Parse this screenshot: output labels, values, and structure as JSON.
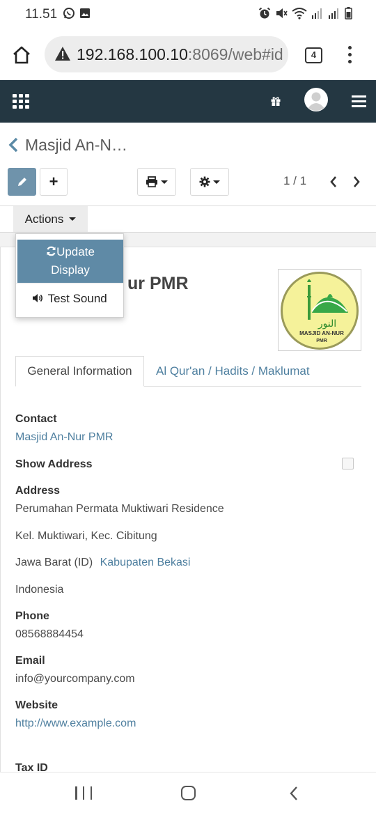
{
  "status_bar": {
    "time": "11.51",
    "left_icons": [
      "whatsapp-icon",
      "image-icon"
    ],
    "right_icons": [
      "alarm-icon",
      "mute-icon",
      "wifi-icon",
      "signal-icon",
      "signal-icon",
      "battery-icon"
    ]
  },
  "browser": {
    "url_host": "192.168.100.10",
    "url_rest": ":8069/web#id",
    "tab_count": "4",
    "icons": [
      "home-icon",
      "warning-icon",
      "tabs-icon",
      "menu-dots-icon"
    ]
  },
  "navbar": {
    "icons": [
      "apps-grid-icon",
      "gift-icon",
      "avatar-icon",
      "hamburger-icon"
    ],
    "color": "#243742"
  },
  "breadcrumb": {
    "title": "Masjid An-N…"
  },
  "control_panel": {
    "pager": "1 / 1",
    "add_label": "+",
    "accent": "#6f93ab"
  },
  "actions": {
    "label": "Actions",
    "dropdown": {
      "update_line1": "Update",
      "update_line2": "Display",
      "test_sound": "Test Sound"
    }
  },
  "record": {
    "title_visible": "ur PMR",
    "logo_text_arabic": "النور",
    "logo_text_line1": "MASJID AN-NUR",
    "logo_text_line2": "PMR"
  },
  "tabs": [
    {
      "label": "General Information",
      "active": true
    },
    {
      "label": "Al Qur'an / Hadits / Maklumat",
      "active": false
    }
  ],
  "fields": {
    "contact_label": "Contact",
    "contact_value": "Masjid An-Nur PMR",
    "show_address_label": "Show Address",
    "show_address_checked": false,
    "address_label": "Address",
    "address_line1": "Perumahan Permata Muktiwari Residence",
    "address_line2": "Kel. Muktiwari, Kec. Cibitung",
    "address_state": "Jawa Barat (ID)",
    "address_city": "Kabupaten Bekasi",
    "address_country": "Indonesia",
    "phone_label": "Phone",
    "phone_value": "08568884454",
    "email_label": "Email",
    "email_value": "info@yourcompany.com",
    "website_label": "Website",
    "website_value": "http://www.example.com",
    "taxid_label": "Tax ID"
  }
}
